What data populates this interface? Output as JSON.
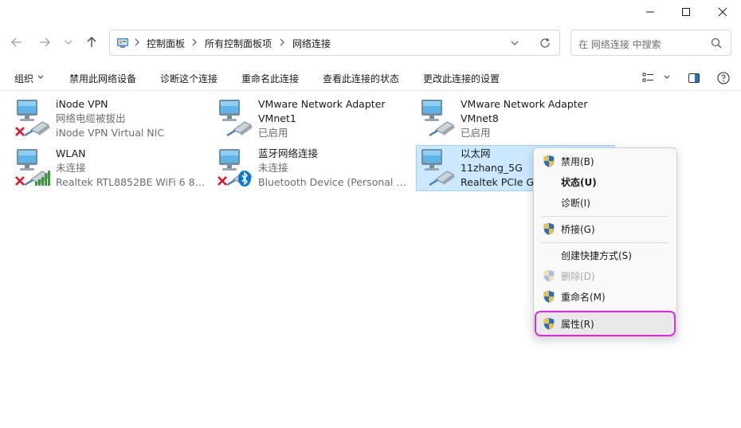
{
  "window": {
    "controls": [
      "minimize-icon",
      "maximize-icon",
      "close-icon"
    ]
  },
  "nav": {
    "icons": [
      "back-arrow-icon",
      "forward-arrow-icon",
      "recent-dropdown-icon",
      "up-arrow-icon"
    ]
  },
  "address": {
    "breadcrumbs": [
      "控制面板",
      "所有控制面板项",
      "网络连接"
    ]
  },
  "search": {
    "placeholder": "在 网络连接 中搜索"
  },
  "toolbar": {
    "organize": "组织",
    "disable": "禁用此网络设备",
    "diagnose": "诊断这个连接",
    "rename": "重命名此连接",
    "view_status": "查看此连接的状态",
    "change_settings": "更改此连接的设置"
  },
  "connections": [
    {
      "name": "iNode VPN",
      "status": "网络电缆被拔出",
      "device": "iNode VPN Virtual NIC",
      "overlay": "red-x-icon"
    },
    {
      "name": "VMware Network Adapter",
      "status": "VMnet1",
      "device": "已启用",
      "overlay": "none"
    },
    {
      "name": "VMware Network Adapter",
      "status": "VMnet8",
      "device": "已启用",
      "overlay": "none"
    },
    {
      "name": "WLAN",
      "status": "未连接",
      "device": "Realtek RTL8852BE WiFi 6 802....",
      "overlay": "wifi-signal-icon"
    },
    {
      "name": "蓝牙网络连接",
      "status": "未连接",
      "device": "Bluetooth Device (Personal Ar...",
      "overlay": "bluetooth-icon"
    },
    {
      "name": "以太网",
      "status": "11zhang_5G",
      "device": "Realtek PCIe Gb",
      "overlay": "none"
    }
  ],
  "context_menu": {
    "items": [
      {
        "label": "禁用(B)",
        "shield": true,
        "bold": false,
        "disabled": false
      },
      {
        "label": "状态(U)",
        "shield": false,
        "bold": true,
        "disabled": false
      },
      {
        "label": "诊断(I)",
        "shield": false,
        "bold": false,
        "disabled": false
      },
      {
        "label": "桥接(G)",
        "shield": true,
        "bold": false,
        "disabled": false
      },
      {
        "label": "创建快捷方式(S)",
        "shield": false,
        "bold": false,
        "disabled": false
      },
      {
        "label": "删除(D)",
        "shield": true,
        "bold": false,
        "disabled": true
      },
      {
        "label": "重命名(M)",
        "shield": true,
        "bold": false,
        "disabled": false
      },
      {
        "label": "属性(R)",
        "shield": true,
        "bold": false,
        "disabled": false,
        "highlighted": true
      }
    ]
  },
  "colors": {
    "selection_bg": "#cce8ff",
    "selection_border": "#99d1ff",
    "highlight_outline": "#e622e6",
    "disabled_x": "#e81123",
    "wifi_green": "#3a9a3a",
    "bluetooth_blue": "#0078d7"
  }
}
